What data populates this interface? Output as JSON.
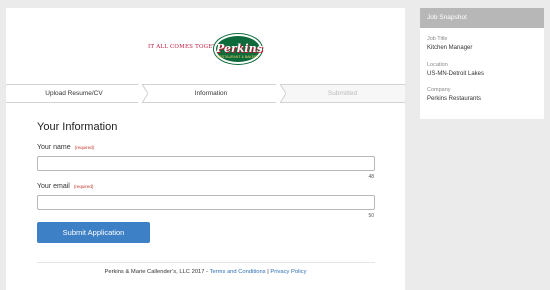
{
  "brand": {
    "tagline_prefix": "IT ALL COMES TOGETHER AT",
    "logo_word": "Perkins",
    "logo_sub": "RESTAURANT & BAKERY",
    "colors": {
      "green": "#0d6a3a",
      "red": "#c0163c"
    }
  },
  "steps": [
    {
      "label": "Upload Resume/CV"
    },
    {
      "label": "Information"
    },
    {
      "label": "Submitted"
    }
  ],
  "form": {
    "title": "Your Information",
    "name_label": "Your name",
    "name_required": "(required)",
    "name_value": "",
    "name_counter": "48",
    "email_label": "Your email",
    "email_required": "(required)",
    "email_value": "",
    "email_counter": "50",
    "submit_label": "Submit Application",
    "submit_color": "#3d80c6"
  },
  "footer": {
    "copyright": "Perkins & Marie Callender’s, LLC 2017 -",
    "terms_label": "Terms and Conditions",
    "separator": "|",
    "privacy_label": "Privacy Policy"
  },
  "job_snapshot": {
    "heading": "Job Snapshot",
    "fields": [
      {
        "label": "Job Title",
        "value": "Kitchen Manager"
      },
      {
        "label": "Location",
        "value": "US-MN-Detroit Lakes"
      },
      {
        "label": "Company",
        "value": "Perkins Restaurants"
      }
    ]
  }
}
